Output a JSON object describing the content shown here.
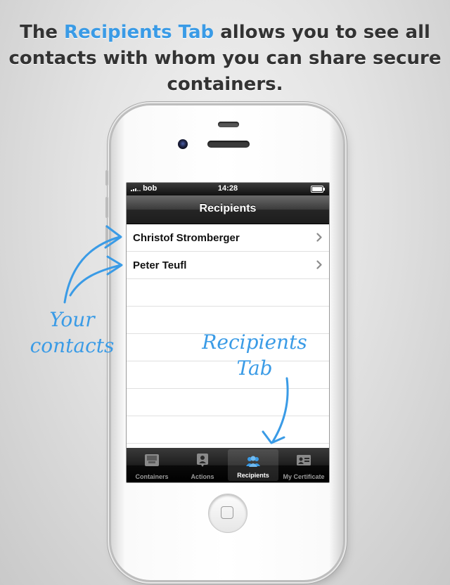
{
  "headline": {
    "before": "The ",
    "highlight": "Recipients Tab",
    "after": " allows you to see all contacts with whom you can share secure containers."
  },
  "status_bar": {
    "carrier": "bob",
    "time": "14:28"
  },
  "nav": {
    "title": "Recipients"
  },
  "contacts": [
    {
      "name": "Christof Stromberger"
    },
    {
      "name": "Peter Teufl"
    }
  ],
  "tabs": [
    {
      "label": "Containers",
      "icon": "tray-icon",
      "active": false
    },
    {
      "label": "Actions",
      "icon": "person-share-icon",
      "active": false
    },
    {
      "label": "Recipients",
      "icon": "people-icon",
      "active": true
    },
    {
      "label": "My Certificate",
      "icon": "id-card-icon",
      "active": false
    }
  ],
  "annotations": {
    "contacts_line1": "Your",
    "contacts_line2": "contacts",
    "tab_line1": "Recipients",
    "tab_line2": "Tab"
  },
  "colors": {
    "accent": "#3a9be6",
    "headline_text": "#333333"
  }
}
